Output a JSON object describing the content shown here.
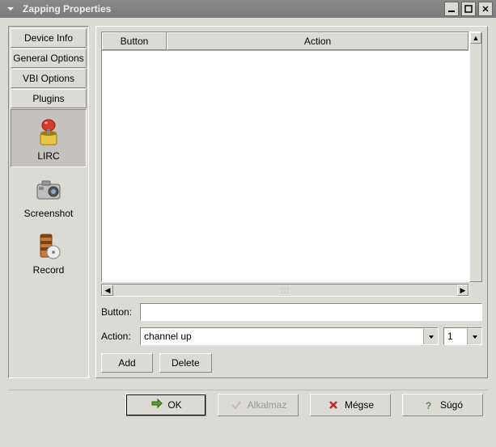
{
  "window": {
    "title": "Zapping Properties"
  },
  "sidebar": {
    "tabs": [
      "Device Info",
      "General Options",
      "VBI Options",
      "Plugins"
    ],
    "items": [
      {
        "label": "LIRC"
      },
      {
        "label": "Screenshot"
      },
      {
        "label": "Record"
      }
    ]
  },
  "table": {
    "headers": {
      "button": "Button",
      "action": "Action"
    }
  },
  "form": {
    "button_label": "Button:",
    "button_value": "",
    "action_label": "Action:",
    "action_value": "channel up",
    "number_value": "1"
  },
  "actions": {
    "add": "Add",
    "delete": "Delete"
  },
  "dialog": {
    "ok": "OK",
    "apply": "Alkalmaz",
    "cancel": "Mégse",
    "help": "Súgó"
  }
}
